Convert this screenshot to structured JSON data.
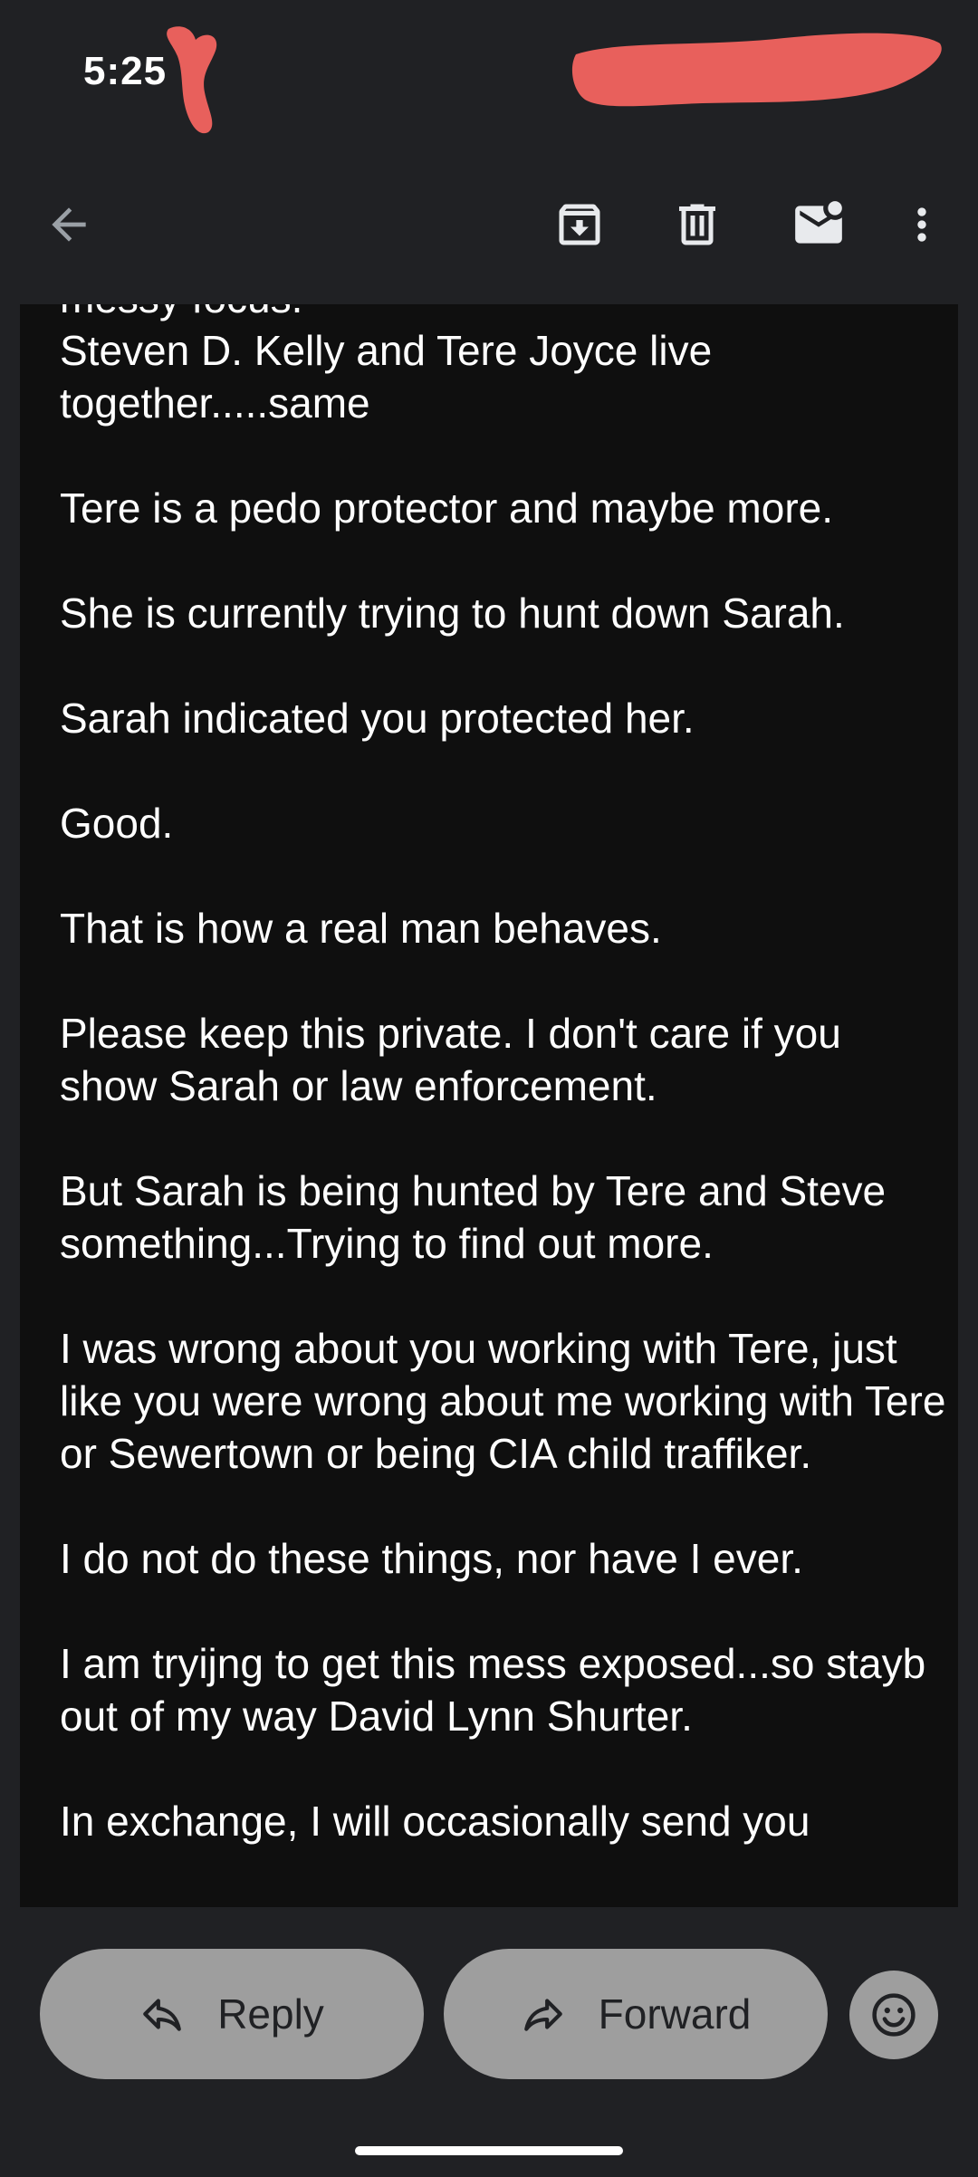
{
  "status_bar": {
    "time": "5:25"
  },
  "app_bar": {
    "back_icon": "arrow-back-icon",
    "archive_icon": "archive-icon",
    "delete_icon": "delete-icon",
    "mark_unread_icon": "mark-unread-icon",
    "more_icon": "more-vert-icon"
  },
  "message": {
    "paragraphs": [
      "messy focus.\nSteven D. Kelly and Tere Joyce live together.....same",
      "Tere is a pedo protector and maybe more.",
      "She is currently trying to hunt down Sarah.",
      "Sarah indicated you protected her.",
      "Good.",
      "That is how a real man behaves.",
      "Please keep this private. I don't care if you show Sarah or law enforcement.",
      "But Sarah is being hunted by Tere and Steve something...Trying to find out more.",
      "I was wrong about you working with Tere, just like you were wrong about me working with Tere or Sewertown or being CIA child traffiker.",
      "I do not do these things, nor have I ever.",
      "I am tryijng to get this mess exposed...so stayb out of my way David Lynn Shurter.",
      "In exchange, I will occasionally send you"
    ]
  },
  "actions": {
    "reply_label": "Reply",
    "forward_label": "Forward",
    "emoji_icon": "emoji-icon"
  },
  "colors": {
    "background": "#202124",
    "message_background": "#0f0f0f",
    "pill_background": "#9e9e9e",
    "redaction": "#e8605c",
    "text": "#ffffff"
  }
}
